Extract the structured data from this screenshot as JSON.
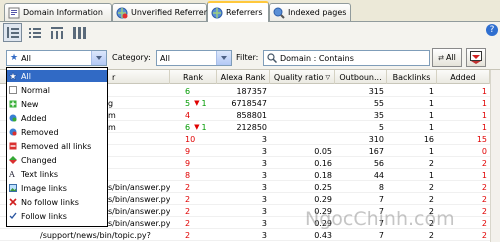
{
  "tabs": [
    {
      "label": "Domain Information",
      "icon": "info-icon"
    },
    {
      "label": "Unverified Referrers",
      "icon": "unverified-globe-icon"
    },
    {
      "label": "Referrers",
      "icon": "globe-icon",
      "active": true
    },
    {
      "label": "Indexed pages",
      "icon": "search-globe-icon"
    }
  ],
  "toolbar": {
    "filter_mode": "All",
    "category_label": "Category:",
    "category_value": "All",
    "filter_label": "Filter:",
    "filter_value": "Domain : Contains",
    "apply_all_label": "All"
  },
  "dropdown": {
    "items": [
      {
        "label": "All",
        "icon": "star-icon",
        "selected": true
      },
      {
        "label": "Normal",
        "icon": "normal-icon"
      },
      {
        "label": "New",
        "icon": "plus-icon"
      },
      {
        "label": "Added",
        "icon": "added-icon"
      },
      {
        "label": "Removed",
        "icon": "removed-icon"
      },
      {
        "label": "Removed all links",
        "icon": "removed-all-icon"
      },
      {
        "label": "Changed",
        "icon": "changed-icon"
      },
      {
        "label": "Text links",
        "icon": "text-link-icon"
      },
      {
        "label": "Image links",
        "icon": "image-link-icon"
      },
      {
        "label": "No follow links",
        "icon": "no-follow-icon"
      },
      {
        "label": "Follow links",
        "icon": "follow-icon"
      }
    ]
  },
  "table": {
    "columns": [
      "r",
      "Rank",
      "Alexa Rank",
      "Quality ratio",
      "Outboun...",
      "Backlinks",
      "Added"
    ],
    "rows": [
      {
        "url": "",
        "rank": "6",
        "rank_color": "green",
        "delta": "",
        "alexa": "187357",
        "quality": "",
        "outbound": "315",
        "backlinks": "1",
        "added": "1"
      },
      {
        "url": "g",
        "rank": "5",
        "rank_color": "green",
        "delta": "1",
        "alexa": "6718547",
        "quality": "",
        "outbound": "55",
        "backlinks": "1",
        "added": "1"
      },
      {
        "url": "m",
        "rank": "4",
        "rank_color": "red",
        "delta": "",
        "alexa": "858801",
        "quality": "",
        "outbound": "35",
        "backlinks": "1",
        "added": "1"
      },
      {
        "url": "m",
        "rank": "6",
        "rank_color": "green",
        "delta": "1",
        "alexa": "212850",
        "quality": "",
        "outbound": "5",
        "backlinks": "1",
        "added": "1"
      },
      {
        "url": "",
        "rank": "10",
        "rank_color": "red",
        "delta": "",
        "alexa": "3",
        "quality": "",
        "outbound": "310",
        "backlinks": "16",
        "added": "15"
      },
      {
        "url": "",
        "rank": "9",
        "rank_color": "red",
        "delta": "",
        "alexa": "3",
        "quality": "0.05",
        "outbound": "167",
        "backlinks": "1",
        "added": "0"
      },
      {
        "url": "",
        "rank": "9",
        "rank_color": "red",
        "delta": "",
        "alexa": "3",
        "quality": "0.16",
        "outbound": "56",
        "backlinks": "2",
        "added": "2"
      },
      {
        "url": "",
        "rank": "8",
        "rank_color": "red",
        "delta": "",
        "alexa": "3",
        "quality": "0.18",
        "outbound": "44",
        "backlinks": "1",
        "added": "1"
      },
      {
        "url": "s/bin/answer.py?",
        "rank": "2",
        "rank_color": "red",
        "delta": "",
        "alexa": "3",
        "quality": "0.25",
        "outbound": "8",
        "backlinks": "2",
        "added": "2"
      },
      {
        "url": "s/bin/answer.py?",
        "rank": "2",
        "rank_color": "red",
        "delta": "",
        "alexa": "3",
        "quality": "0.29",
        "outbound": "7",
        "backlinks": "2",
        "added": "2"
      },
      {
        "url": "s/bin/answer.py?",
        "rank": "2",
        "rank_color": "red",
        "delta": "",
        "alexa": "3",
        "quality": "0.29",
        "outbound": "7",
        "backlinks": "2",
        "added": "2"
      },
      {
        "url": "s/bin/answer.py?",
        "rank": "2",
        "rank_color": "red",
        "delta": "",
        "alexa": "3",
        "quality": "0.29",
        "outbound": "7",
        "backlinks": "2",
        "added": "2"
      },
      {
        "url": "/support/news/bin/topic.py?",
        "rank": "2",
        "rank_color": "red",
        "delta": "",
        "alexa": "3",
        "quality": "0.43",
        "outbound": "7",
        "backlinks": "2",
        "added": "2"
      }
    ]
  },
  "watermark": "NgocChinh.com",
  "colors": {
    "accent": "#316ac5",
    "rank_up": "#009a00",
    "rank_down": "#e00000"
  }
}
